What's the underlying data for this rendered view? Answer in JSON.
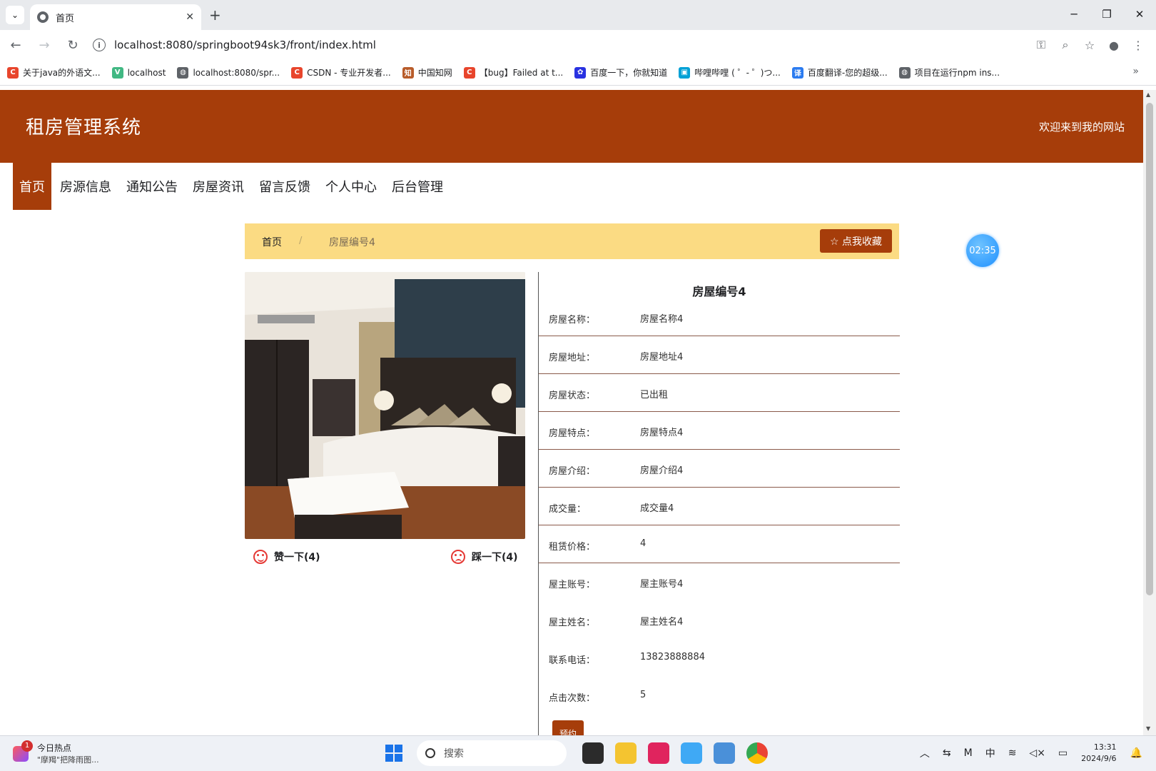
{
  "browser": {
    "tab_title": "首页",
    "url": "localhost:8080/springboot94sk3/front/index.html",
    "bookmarks": [
      {
        "label": "关于java的外语文...",
        "color": "#e8452c",
        "glyph": "C"
      },
      {
        "label": "localhost",
        "color": "#41b883",
        "glyph": "V"
      },
      {
        "label": "localhost:8080/spr...",
        "color": "#5f6368",
        "glyph": "◍"
      },
      {
        "label": "CSDN - 专业开发者...",
        "color": "#e8452c",
        "glyph": "C"
      },
      {
        "label": "中国知网",
        "color": "#b85c2a",
        "glyph": "知"
      },
      {
        "label": "【bug】Failed at t...",
        "color": "#e8452c",
        "glyph": "C"
      },
      {
        "label": "百度一下，你就知道",
        "color": "#2932e1",
        "glyph": "✿"
      },
      {
        "label": "哔哩哔哩 ( ゜- ゜)つ...",
        "color": "#00a1d6",
        "glyph": "▣"
      },
      {
        "label": "百度翻译-您的超级...",
        "color": "#2b7bf0",
        "glyph": "译"
      },
      {
        "label": "项目在运行npm ins...",
        "color": "#5f6368",
        "glyph": "◍"
      }
    ]
  },
  "site": {
    "title": "租房管理系统",
    "welcome": "欢迎来到我的网站",
    "nav": [
      "首页",
      "房源信息",
      "通知公告",
      "房屋资讯",
      "留言反馈",
      "个人中心",
      "后台管理"
    ],
    "breadcrumb": {
      "home": "首页",
      "separator": "/",
      "current": "房屋编号4"
    },
    "favorite_button": "☆ 点我收藏",
    "timer": "02:35"
  },
  "house": {
    "title": "房屋编号4",
    "fields": [
      {
        "key": "房屋名称：",
        "value": "房屋名称4"
      },
      {
        "key": "房屋地址：",
        "value": "房屋地址4"
      },
      {
        "key": "房屋状态：",
        "value": "已出租"
      },
      {
        "key": "房屋特点：",
        "value": "房屋特点4"
      },
      {
        "key": "房屋介绍：",
        "value": "房屋介绍4"
      },
      {
        "key": "成交量：",
        "value": "成交量4"
      },
      {
        "key": "租赁价格：",
        "value": "4"
      },
      {
        "key": "屋主账号：",
        "value": "屋主账号4"
      },
      {
        "key": "屋主姓名：",
        "value": "屋主姓名4"
      },
      {
        "key": "联系电话：",
        "value": "13823888884"
      },
      {
        "key": "点击次数：",
        "value": "5"
      }
    ],
    "book_button": "预约",
    "like": "赞一下(4)",
    "dislike": "踩一下(4)"
  },
  "taskbar": {
    "news_title": "今日热点",
    "news_sub": "\"摩羯\"把降雨图...",
    "news_badge": "1",
    "search": "搜索",
    "ime": "中",
    "time": "13:31",
    "date": "2024/9/6"
  },
  "colors": {
    "brand": "#a63d0a",
    "crumb_bg": "#fbdb83"
  }
}
